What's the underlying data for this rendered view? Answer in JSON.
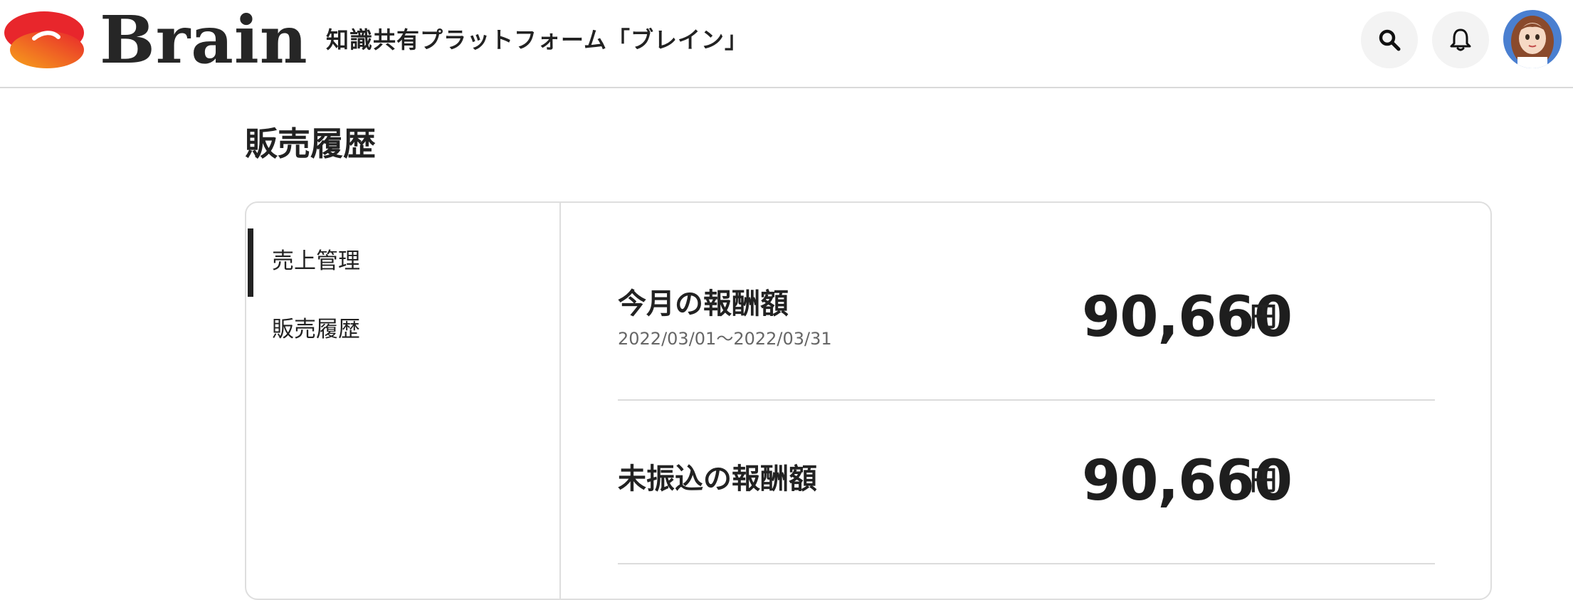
{
  "header": {
    "brand": "Brain",
    "tagline": "知識共有プラットフォーム「ブレイン」",
    "search_icon": "search-icon",
    "bell_icon": "bell-icon",
    "colors": {
      "logo_red": "#e8262c",
      "logo_orange": "#f7931e",
      "icon_bg": "#f3f3f3"
    }
  },
  "page": {
    "title": "販売履歴"
  },
  "sidebar": {
    "items": [
      {
        "label": "売上管理",
        "active": true
      },
      {
        "label": "販売履歴",
        "active": false
      }
    ]
  },
  "summary": {
    "monthly": {
      "title": "今月の報酬額",
      "period": "2022/03/01〜2022/03/31",
      "amount": "90,660",
      "unit": "円"
    },
    "untransferred": {
      "title": "未振込の報酬額",
      "amount": "90,660",
      "unit": "円"
    }
  }
}
